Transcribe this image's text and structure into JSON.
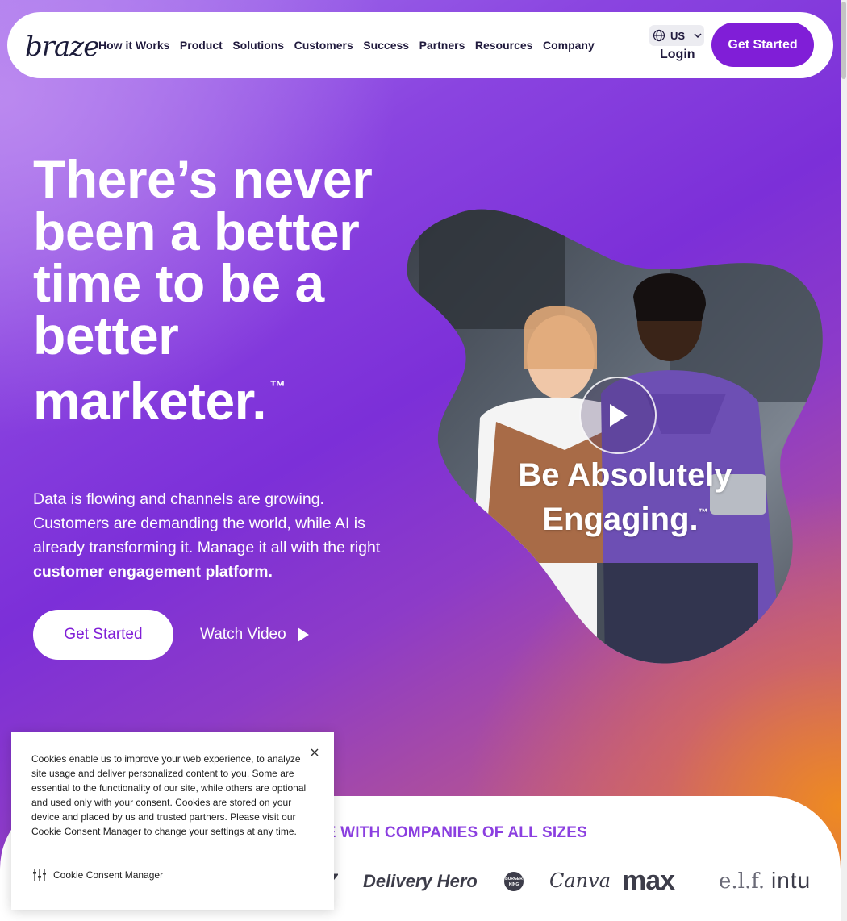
{
  "brand": {
    "logo_text": "braze",
    "accent": "#801ED7"
  },
  "nav": {
    "links": [
      "How it Works",
      "Product",
      "Solutions",
      "Customers",
      "Success",
      "Partners",
      "Resources",
      "Company"
    ],
    "region": "US",
    "login": "Login",
    "cta": "Get Started"
  },
  "hero": {
    "headline": "There’s never been a better time to be a better marketer.",
    "trademark": "™",
    "subtext_plain": "Data is flowing and channels are growing. Customers are demanding the world, while AI is already transforming it. Manage it all with the right ",
    "subtext_bold": "customer engagement platform.",
    "cta": "Get Started",
    "watch_video": "Watch Video",
    "video_caption": "Be Absolutely Engaging.",
    "video_trademark": "™"
  },
  "logos": {
    "heading": "ALE WITH COMPANIES OF ALL SIZES",
    "items": [
      "Delivery Hero",
      "BURGER KING",
      "Canva",
      "max",
      "e.l.f.",
      "intu"
    ]
  },
  "cookie": {
    "text": "Cookies enable us to improve your web experience, to analyze site usage and deliver personalized content to you. Some are essential to the functionality of our site, while others are optional and used only with your consent. Cookies are stored on your device and placed by us and trusted partners. Please visit our Cookie Consent Manager to change your settings at any time.",
    "manager_label": "Cookie Consent Manager"
  }
}
